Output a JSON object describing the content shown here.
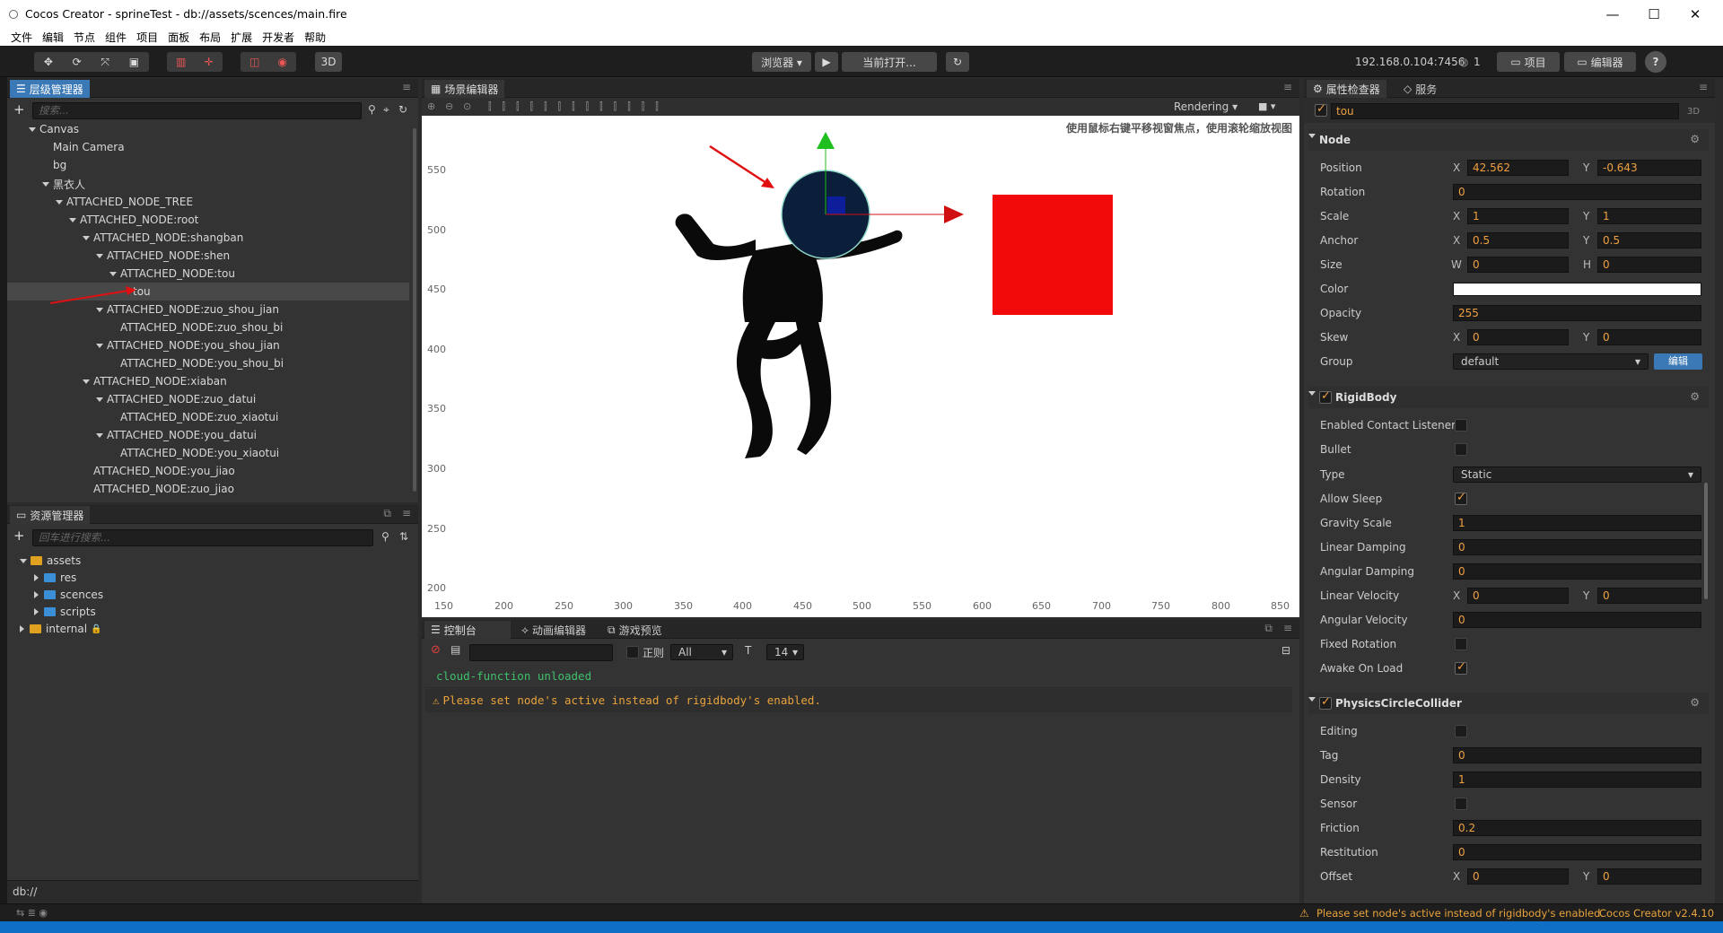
{
  "window": {
    "title": "Cocos Creator - sprineTest - db://assets/scences/main.fire",
    "minimize": "—",
    "maximize": "☐",
    "close": "✕"
  },
  "menu": [
    "文件",
    "编辑",
    "节点",
    "组件",
    "项目",
    "面板",
    "布局",
    "扩展",
    "开发者",
    "帮助"
  ],
  "toolbar": {
    "mode_3d": "3D",
    "preview_target": "浏览器 ▾",
    "play_icon": "▶",
    "scene_dropdown": "当前打开...",
    "refresh_icon": "↻",
    "ip_address": "192.168.0.104:7456",
    "wifi_count": "1",
    "project_btn": "项目",
    "editor_btn": "编辑器",
    "help_icon": "?"
  },
  "hierarchy": {
    "tab": "层级管理器",
    "search_placeholder": "搜索...",
    "rows": [
      "Canvas",
      "Main Camera",
      "bg",
      "黑衣人",
      "ATTACHED_NODE_TREE",
      "ATTACHED_NODE:root",
      "ATTACHED_NODE:shangban",
      "ATTACHED_NODE:shen",
      "ATTACHED_NODE:tou",
      "tou",
      "ATTACHED_NODE:zuo_shou_jian",
      "ATTACHED_NODE:zuo_shou_bi",
      "ATTACHED_NODE:you_shou_jian",
      "ATTACHED_NODE:you_shou_bi",
      "ATTACHED_NODE:xiaban",
      "ATTACHED_NODE:zuo_datui",
      "ATTACHED_NODE:zuo_xiaotui",
      "ATTACHED_NODE:you_datui",
      "ATTACHED_NODE:you_xiaotui",
      "ATTACHED_NODE:you_jiao",
      "ATTACHED_NODE:zuo_jiao"
    ]
  },
  "assets": {
    "tab": "资源管理器",
    "search_placeholder": "回车进行搜索...",
    "rows": [
      "assets",
      "res",
      "scences",
      "scripts",
      "internal"
    ],
    "footer": "db://"
  },
  "scene": {
    "tab": "场景编辑器",
    "rendering": "Rendering",
    "hint": "使用鼠标右键平移视窗焦点，使用滚轮缩放视图",
    "y_ticks": [
      "550",
      "500",
      "450",
      "400",
      "350",
      "300",
      "250",
      "200"
    ],
    "x_ticks": [
      "150",
      "200",
      "250",
      "300",
      "350",
      "400",
      "450",
      "500",
      "550",
      "600",
      "650",
      "700",
      "750",
      "800",
      "850"
    ],
    "colors": {
      "box": "#f20a0a",
      "head": "#0b1f3a",
      "gizmo_y": "#1fbf1f",
      "gizmo_x": "#d01010"
    }
  },
  "console": {
    "tabs": [
      "控制台",
      "动画编辑器",
      "游戏预览"
    ],
    "regex_label": "正则",
    "level": "All",
    "font_size": "14",
    "logs": [
      {
        "text": "cloud-function unloaded",
        "color": "#3fc06a"
      },
      {
        "text": "Please set node's active instead of rigidbody's enabled.",
        "color": "#e8a33c"
      }
    ]
  },
  "inspector": {
    "tab": "属性检查器",
    "tab2": "服务",
    "node_name": "tou",
    "badge_3d": "3D",
    "node_section": "Node",
    "node_props": {
      "position": {
        "label": "Position",
        "x": "42.562",
        "y": "-0.643"
      },
      "rotation": {
        "label": "Rotation",
        "value": "0"
      },
      "scale": {
        "label": "Scale",
        "x": "1",
        "y": "1"
      },
      "anchor": {
        "label": "Anchor",
        "x": "0.5",
        "y": "0.5"
      },
      "size": {
        "label": "Size",
        "w": "0",
        "h": "0"
      },
      "color": {
        "label": "Color"
      },
      "opacity": {
        "label": "Opacity",
        "value": "255"
      },
      "skew": {
        "label": "Skew",
        "x": "0",
        "y": "0"
      },
      "group": {
        "label": "Group",
        "value": "default",
        "edit": "编辑"
      }
    },
    "rigidbody_section": "RigidBody",
    "rigidbody": {
      "enabled_contact_listener": "Enabled Contact Listener",
      "bullet": "Bullet",
      "type_label": "Type",
      "type_value": "Static",
      "allow_sleep": "Allow Sleep",
      "gravity_scale": {
        "label": "Gravity Scale",
        "value": "1"
      },
      "linear_damping": {
        "label": "Linear Damping",
        "value": "0"
      },
      "angular_damping": {
        "label": "Angular Damping",
        "value": "0"
      },
      "linear_velocity": {
        "label": "Linear Velocity",
        "x": "0",
        "y": "0"
      },
      "angular_velocity": {
        "label": "Angular Velocity",
        "value": "0"
      },
      "fixed_rotation": "Fixed Rotation",
      "awake_on_load": "Awake On Load"
    },
    "collider_section": "PhysicsCircleCollider",
    "collider": {
      "editing": "Editing",
      "tag": {
        "label": "Tag",
        "value": "0"
      },
      "density": {
        "label": "Density",
        "value": "1"
      },
      "sensor": "Sensor",
      "friction": {
        "label": "Friction",
        "value": "0.2"
      },
      "restitution": {
        "label": "Restitution",
        "value": "0"
      },
      "offset": {
        "label": "Offset",
        "x": "0",
        "y": "0"
      }
    }
  },
  "statusbar": {
    "warning": "Please set node's active instead of rigidbody's enabled.",
    "version": "Cocos Creator v2.4.10"
  }
}
